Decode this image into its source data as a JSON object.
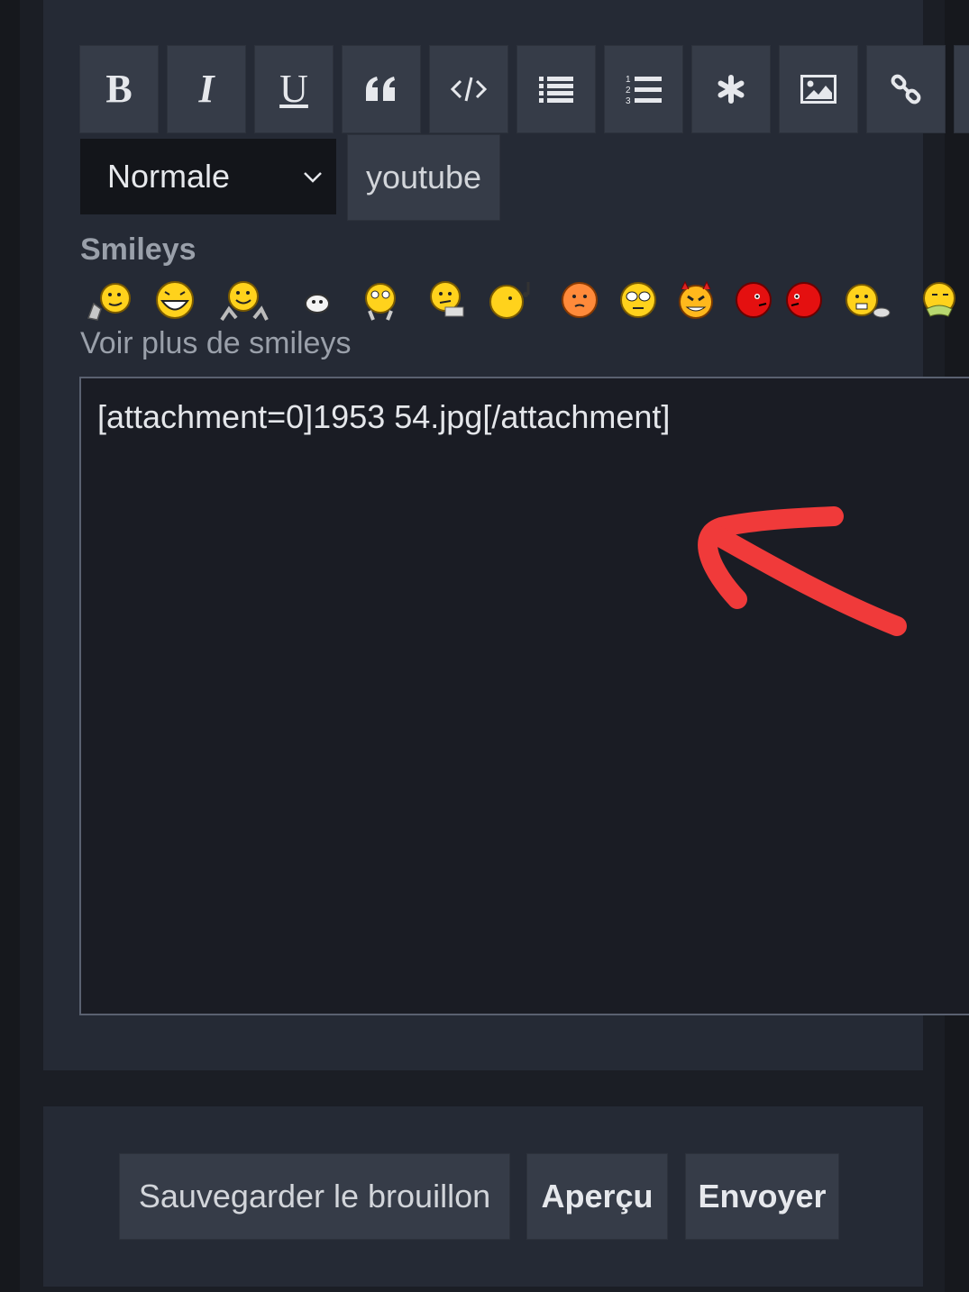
{
  "toolbar": {
    "buttons": [
      {
        "name": "bold",
        "icon": "bold-icon",
        "glyph": "B"
      },
      {
        "name": "italic",
        "icon": "italic-icon",
        "glyph": "I"
      },
      {
        "name": "underline",
        "icon": "underline-icon",
        "glyph": "U"
      },
      {
        "name": "quote",
        "icon": "quote-icon"
      },
      {
        "name": "code",
        "icon": "code-icon"
      },
      {
        "name": "bullet-list",
        "icon": "bullet-list-icon"
      },
      {
        "name": "numbered-list",
        "icon": "numbered-list-icon"
      },
      {
        "name": "spoiler",
        "icon": "asterisk-icon"
      },
      {
        "name": "image",
        "icon": "image-icon"
      },
      {
        "name": "link",
        "icon": "link-icon"
      }
    ],
    "font_size_selected": "Normale",
    "youtube_label": "youtube"
  },
  "smileys": {
    "label": "Smileys",
    "icons": [
      "smiley-thumbs-icon",
      "smiley-laugh-icon",
      "smiley-wave-icon",
      "smiley-small-icon",
      "smiley-cry-icon",
      "smiley-think-icon",
      "smiley-music-icon",
      "smiley-blush-icon",
      "smiley-eyeroll-icon",
      "smiley-devil-icon",
      "smiley-angry-red-icon",
      "smiley-angry-red2-icon",
      "smiley-shock-icon",
      "smiley-sick-icon"
    ],
    "more_link": "Voir plus de smileys"
  },
  "editor": {
    "content": "[attachment=0]1953 54.jpg[/attachment]"
  },
  "actions": {
    "save_draft": "Sauvegarder le brouillon",
    "preview": "Aperçu",
    "send": "Envoyer"
  },
  "colors": {
    "background": "#1b1e25",
    "panel": "#252a35",
    "button": "#363c48",
    "annotation_arrow": "#f03a3a"
  }
}
